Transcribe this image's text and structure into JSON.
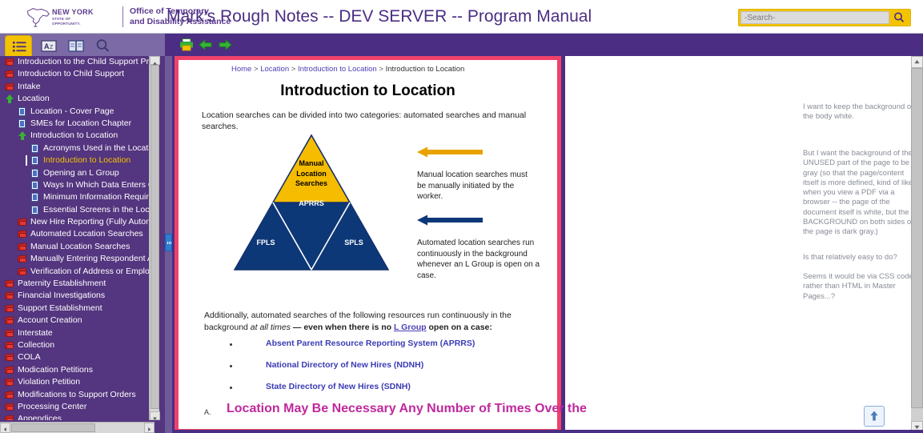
{
  "brand": {
    "logo_line1": "NEW YORK",
    "logo_line2": "STATE OF",
    "logo_line3": "OPPORTUNITY.",
    "agency_line1": "Office of Temporary",
    "agency_line2": "and Disability Assistance",
    "app_title": "Mark's Rough Notes -- DEV SERVER -- Program Manual",
    "logo_icon": "new-york-state-outline-icon"
  },
  "search": {
    "placeholder": "-Search-",
    "value": "",
    "button_icon": "search-icon"
  },
  "sidebar_tabs": [
    {
      "name": "contents",
      "icon": "list-icon",
      "label": "Contents",
      "active": true
    },
    {
      "name": "index",
      "icon": "index-az-icon",
      "label": "Index",
      "active": false
    },
    {
      "name": "glossary",
      "icon": "book-open-icon",
      "label": "Glossary",
      "active": false
    },
    {
      "name": "search",
      "icon": "magnifier-icon",
      "label": "Search",
      "active": false
    }
  ],
  "toolbar": {
    "print_label": "Print",
    "print_icon": "printer-icon",
    "back_label": "Back",
    "back_icon": "arrow-left-icon",
    "forward_label": "Forward",
    "forward_icon": "arrow-right-icon"
  },
  "toc": [
    {
      "label": "Introduction to the Child Support Program Manual",
      "indent": 0,
      "icon": "book-icon",
      "selected": false
    },
    {
      "label": "Introduction to Child Support",
      "indent": 0,
      "icon": "book-icon",
      "selected": false
    },
    {
      "label": "Intake",
      "indent": 0,
      "icon": "book-icon",
      "selected": false
    },
    {
      "label": "Location",
      "indent": 0,
      "icon": "arrow-icon",
      "selected": false
    },
    {
      "label": "Location - Cover Page",
      "indent": 1,
      "icon": "page-icon",
      "selected": false
    },
    {
      "label": "SMEs for Location Chapter",
      "indent": 1,
      "icon": "page-icon",
      "selected": false
    },
    {
      "label": "Introduction to Location",
      "indent": 1,
      "icon": "arrow-icon",
      "selected": false
    },
    {
      "label": "Acronyms Used in the Location Chapter",
      "indent": 2,
      "icon": "page-icon",
      "selected": false
    },
    {
      "label": "Introduction to Location",
      "indent": 2,
      "icon": "page-icon",
      "selected": true
    },
    {
      "label": "Opening an L Group",
      "indent": 2,
      "icon": "page-icon",
      "selected": false
    },
    {
      "label": "Ways In Which Data Enters Case Record",
      "indent": 2,
      "icon": "page-icon",
      "selected": false
    },
    {
      "label": "Minimum Information Required to Locate",
      "indent": 2,
      "icon": "page-icon",
      "selected": false
    },
    {
      "label": "Essential Screens in the Location Process",
      "indent": 2,
      "icon": "page-icon",
      "selected": false
    },
    {
      "label": "New Hire Reporting (Fully Automated)",
      "indent": 1,
      "icon": "book-icon",
      "selected": false
    },
    {
      "label": "Automated Location Searches",
      "indent": 1,
      "icon": "book-icon",
      "selected": false
    },
    {
      "label": "Manual Location Searches",
      "indent": 1,
      "icon": "book-icon",
      "selected": false
    },
    {
      "label": "Manually Entering Respondent Address or E",
      "indent": 1,
      "icon": "book-icon",
      "selected": false
    },
    {
      "label": "Verification of Address or Employment",
      "indent": 1,
      "icon": "book-icon",
      "selected": false
    },
    {
      "label": "Paternity Establishment",
      "indent": 0,
      "icon": "book-icon",
      "selected": false
    },
    {
      "label": "Financial Investigations",
      "indent": 0,
      "icon": "book-icon",
      "selected": false
    },
    {
      "label": "Support Establishment",
      "indent": 0,
      "icon": "book-icon",
      "selected": false
    },
    {
      "label": "Account Creation",
      "indent": 0,
      "icon": "book-icon",
      "selected": false
    },
    {
      "label": "Interstate",
      "indent": 0,
      "icon": "book-icon",
      "selected": false
    },
    {
      "label": "Collection",
      "indent": 0,
      "icon": "book-icon",
      "selected": false
    },
    {
      "label": "COLA",
      "indent": 0,
      "icon": "book-icon",
      "selected": false
    },
    {
      "label": "Modication Petitions",
      "indent": 0,
      "icon": "book-icon",
      "selected": false
    },
    {
      "label": "Violation Petition",
      "indent": 0,
      "icon": "book-icon",
      "selected": false
    },
    {
      "label": "Modifications to Support Orders",
      "indent": 0,
      "icon": "book-icon",
      "selected": false
    },
    {
      "label": "Processing Center",
      "indent": 0,
      "icon": "book-icon",
      "selected": false
    },
    {
      "label": "Appendices",
      "indent": 0,
      "icon": "book-icon",
      "selected": false
    }
  ],
  "document": {
    "breadcrumb": [
      {
        "label": "Home",
        "link": true
      },
      {
        "label": "Location",
        "link": true
      },
      {
        "label": "Introduction to Location",
        "link": true
      },
      {
        "label": "Introduction to Location",
        "link": false
      }
    ],
    "breadcrumb_separator": ">",
    "title": "Introduction to Location",
    "intro_paragraph": "Location searches can be divided into two categories:  automated searches and manual searches.",
    "figure": {
      "top_label": "Manual Location Searches",
      "top_label_lines": [
        "Manual",
        "Location",
        "Searches"
      ],
      "center_label": "APRRS",
      "left_label": "FPLS",
      "right_label": "SPLS",
      "top_color": "#f5bc00",
      "base_color": "#0d3878"
    },
    "callouts": [
      {
        "arrow_color": "#e8a200",
        "arrow_icon": "arrow-left-icon",
        "text": "Manual location searches must be manually initiated by the worker."
      },
      {
        "arrow_color": "#0d3878",
        "arrow_icon": "arrow-left-icon",
        "text": "Automated location searches run continuously in the background whenever an L Group is open on a case."
      }
    ],
    "additional_paragraph": {
      "part1": "Additionally, automated searches of the following resources run continuously in the background ",
      "italic1": "at all times",
      "part2": " — ",
      "bold1": "even when there is no ",
      "link": "L Group",
      "bold2": " open on a case:"
    },
    "bullets": [
      "Absent Parent Resource Reporting System (APRRS)",
      "National Directory of New Hires (NDNH)",
      "State Directory of New Hires (SDNH)"
    ],
    "section": {
      "marker": "A.",
      "heading": "Location May Be Necessary Any Number of Times Over the"
    }
  },
  "notes": {
    "arrow_icon": "red-curved-arrow-icon",
    "arrow_color": "#f4495a",
    "note1": "I want to keep the background of the body white.",
    "note2": "But I want the background of the UNUSED part of the page to be gray (so that the page/content itself is more defined, kind of like when you view a PDF via a browser -- the page of the document itself is white, but the BACKGROUND on both sides of the page is dark gray.)",
    "note3": "Is that relatively easy to do?",
    "note4": "Seems it would be via CSS code rather than HTML in Master Pages...?"
  },
  "controls": {
    "back_to_top_label": "Back to top",
    "back_to_top_icon": "arrow-up-icon",
    "scroll_up_icon": "caret-up-icon",
    "scroll_down_icon": "caret-down-icon",
    "scroll_left_icon": "caret-left-icon",
    "scroll_right_icon": "caret-right-icon",
    "splitter_label": "Resize sidebar"
  },
  "colors": {
    "brand_purple": "#4b2e83",
    "sidebar_purple": "#54357f",
    "accent_yellow": "#f3c300",
    "page_border_pink": "#f0416b"
  }
}
